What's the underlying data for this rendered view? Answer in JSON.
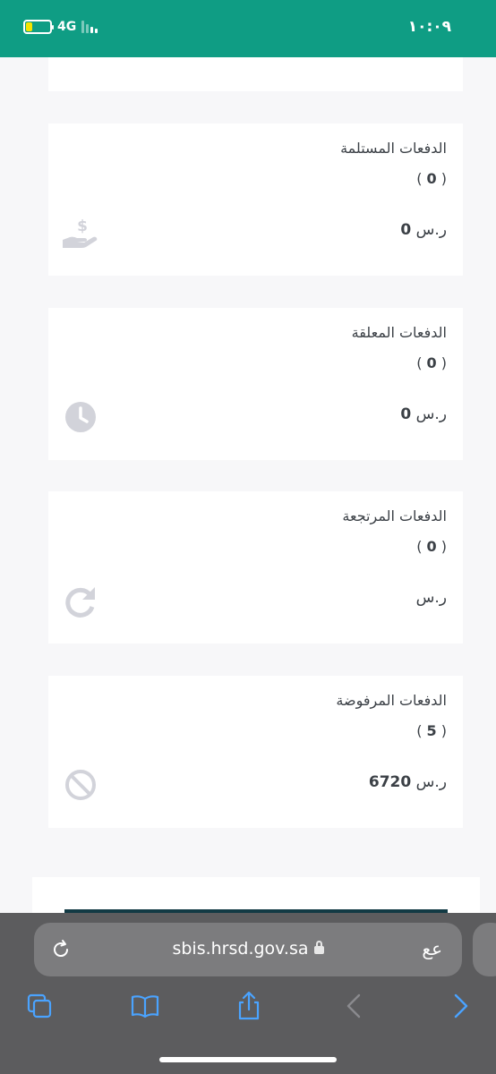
{
  "status_bar": {
    "time": "١٠:٠٩",
    "network": "4G",
    "accent_color": "#0f9d84"
  },
  "cards": [
    {
      "title": "الدفعات المستلمة",
      "count": "0",
      "amount": "0",
      "currency": "ر.س",
      "icon": "hand-dollar-icon"
    },
    {
      "title": "الدفعات المعلقة",
      "count": "0",
      "amount": "0",
      "currency": "ر.س",
      "icon": "clock-icon"
    },
    {
      "title": "الدفعات المرتجعة",
      "count": "0",
      "amount": "",
      "currency": "ر.س",
      "icon": "redo-icon"
    },
    {
      "title": "الدفعات المرفوضة",
      "count": "5",
      "amount": "6720",
      "currency": "ر.س",
      "icon": "ban-icon"
    }
  ],
  "browser": {
    "url": "sbis.hrsd.gov.sa",
    "aa_label": "عع",
    "icons": [
      "reload-icon",
      "tabs-icon",
      "bookmarks-icon",
      "share-icon",
      "back-icon",
      "forward-icon",
      "lock-icon"
    ]
  }
}
